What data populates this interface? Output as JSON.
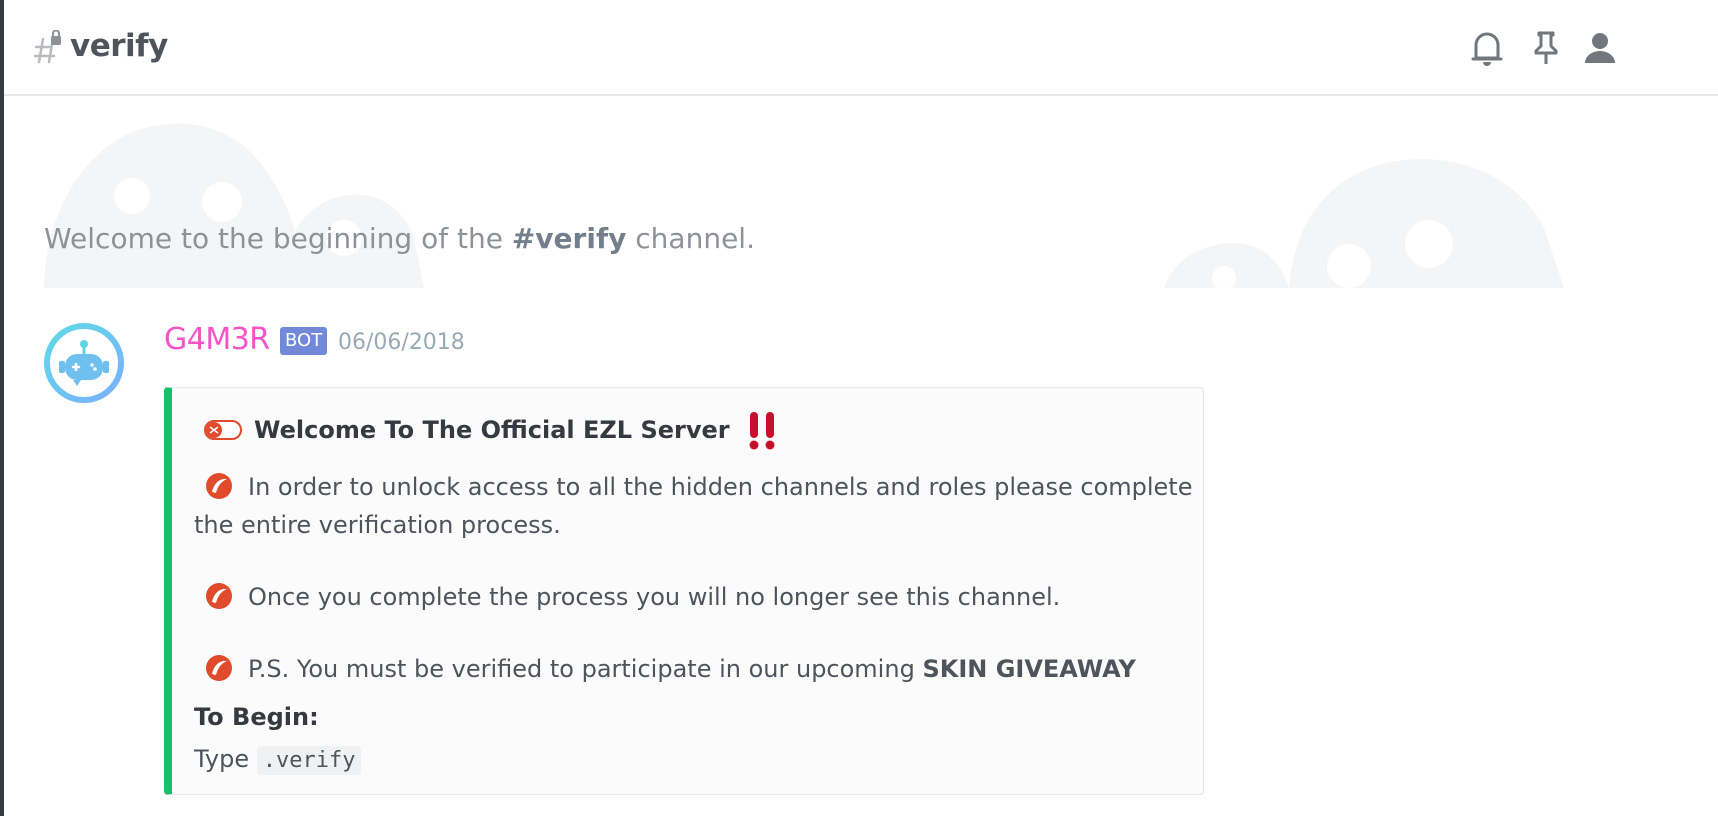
{
  "header": {
    "channel_name": "verify"
  },
  "welcome": {
    "prefix": "Welcome to the beginning of the ",
    "channel": "#verify",
    "suffix": " channel."
  },
  "message": {
    "username": "G4M3R",
    "bot_tag": "BOT",
    "timestamp": "06/06/2018",
    "embed": {
      "accent_color": "#15c26b",
      "title": "Welcome To The Official EZL Server",
      "lines": [
        {
          "text": "In order to unlock access to all the hidden channels and roles please complete the entire verification process."
        },
        {
          "text": "Once you complete the process you will no longer see this channel."
        },
        {
          "text": "P.S. You must be verified to participate in our upcoming ",
          "bold": "SKIN GIVEAWAY"
        }
      ],
      "field_name": "To Begin:",
      "field_prefix": "Type ",
      "field_code": ".verify"
    }
  },
  "colors": {
    "username": "#f454c8",
    "bot_tag_bg": "#7289da"
  },
  "icons": [
    "hash-lock-icon",
    "bell-icon",
    "pin-icon",
    "members-icon",
    "toggle-icon",
    "double-exclamation-icon",
    "red-badge-icon"
  ]
}
